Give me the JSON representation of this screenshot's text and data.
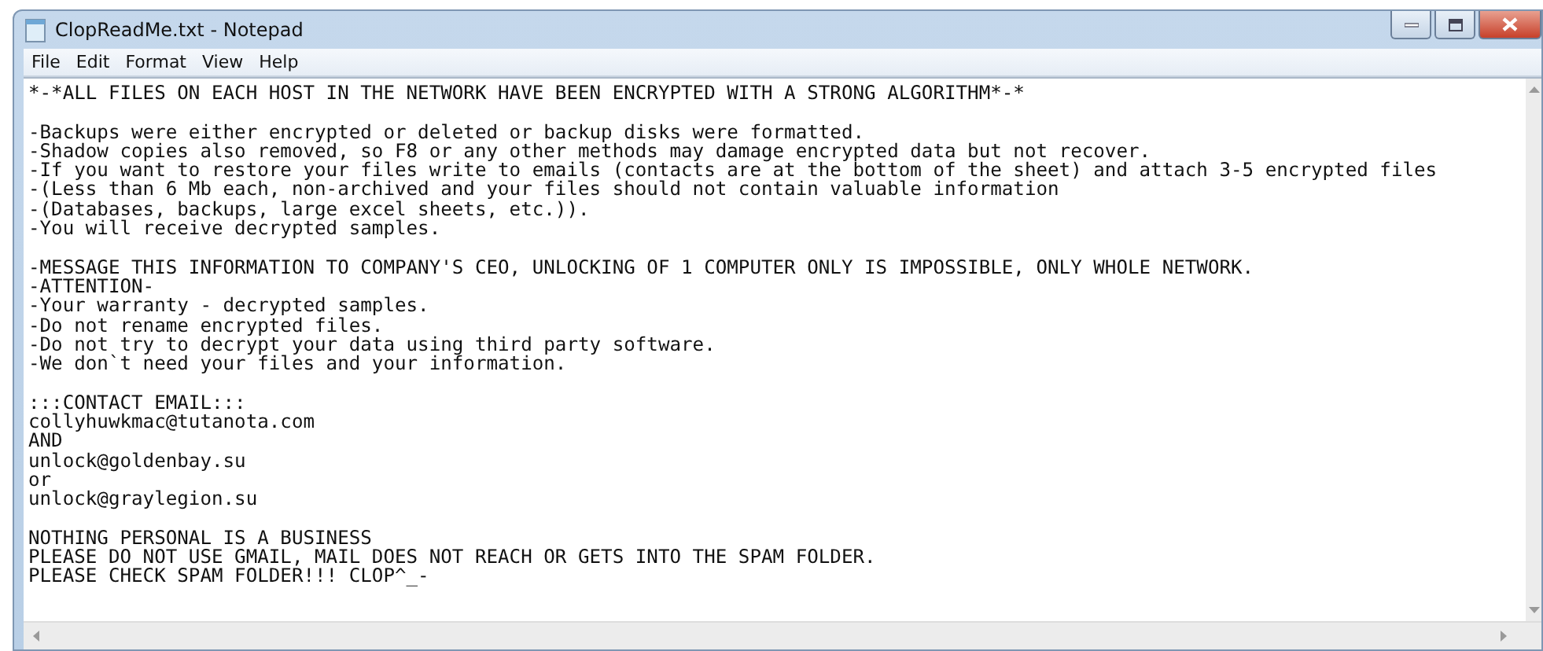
{
  "window": {
    "title": "ClopReadMe.txt - Notepad"
  },
  "menu": [
    "File",
    "Edit",
    "Format",
    "View",
    "Help"
  ],
  "document": {
    "paragraphs": [
      [
        "*-*ALL FILES ON EACH HOST IN THE NETWORK HAVE BEEN ENCRYPTED WITH A STRONG ALGORITHM*-*"
      ],
      [
        "-Backups were either encrypted or deleted or backup disks were formatted.",
        "-Shadow copies also removed, so F8 or any other methods may damage encrypted data but not recover.",
        "-If you want to restore your files write to emails (contacts are at the bottom of the sheet) and attach 3-5 encrypted files",
        "-(Less than 6 Mb each, non-archived and your files should not contain valuable information",
        "-(Databases, backups, large excel sheets, etc.)).",
        "-You will receive decrypted samples."
      ],
      [
        "-MESSAGE THIS INFORMATION TO COMPANY'S CEO, UNLOCKING OF 1 COMPUTER ONLY IS IMPOSSIBLE, ONLY WHOLE NETWORK.",
        "-ATTENTION-",
        "-Your warranty - decrypted samples.",
        "-Do not rename encrypted files.",
        "-Do not try to decrypt your data using third party software.",
        "-We don`t need your files and your information."
      ],
      [
        ":::CONTACT EMAIL:::",
        "collyhuwkmac@tutanota.com",
        "AND",
        "unlock@goldenbay.su",
        "or",
        "unlock@graylegion.su"
      ],
      [
        "NOTHING PERSONAL IS A BUSINESS",
        "PLEASE DO NOT USE GMAIL, MAIL DOES NOT REACH OR GETS INTO THE SPAM FOLDER.",
        "PLEASE CHECK SPAM FOLDER!!! CLOP^_-"
      ]
    ]
  }
}
